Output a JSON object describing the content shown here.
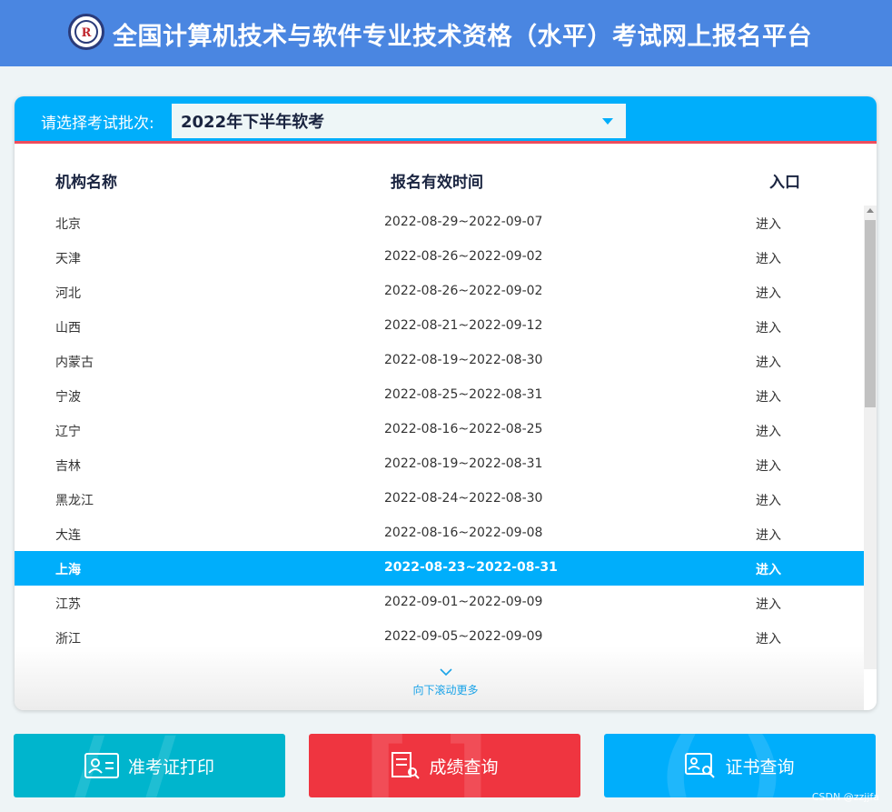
{
  "header": {
    "title": "全国计算机技术与软件专业技术资格（水平）考试网上报名平台"
  },
  "batch": {
    "label": "请选择考试批次:",
    "selected": "2022年下半年软考"
  },
  "table": {
    "headers": [
      "机构名称",
      "报名有效时间",
      "入口"
    ],
    "rows": [
      {
        "name": "北京",
        "period": "2022-08-29~2022-09-07",
        "entry": "进入"
      },
      {
        "name": "天津",
        "period": "2022-08-26~2022-09-02",
        "entry": "进入"
      },
      {
        "name": "河北",
        "period": "2022-08-26~2022-09-02",
        "entry": "进入"
      },
      {
        "name": "山西",
        "period": "2022-08-21~2022-09-12",
        "entry": "进入"
      },
      {
        "name": "内蒙古",
        "period": "2022-08-19~2022-08-30",
        "entry": "进入"
      },
      {
        "name": "宁波",
        "period": "2022-08-25~2022-08-31",
        "entry": "进入"
      },
      {
        "name": "辽宁",
        "period": "2022-08-16~2022-08-25",
        "entry": "进入"
      },
      {
        "name": "吉林",
        "period": "2022-08-19~2022-08-31",
        "entry": "进入"
      },
      {
        "name": "黑龙江",
        "period": "2022-08-24~2022-08-30",
        "entry": "进入"
      },
      {
        "name": "大连",
        "period": "2022-08-16~2022-09-08",
        "entry": "进入"
      },
      {
        "name": "上海",
        "period": "2022-08-23~2022-08-31",
        "entry": "进入",
        "highlighted": true
      },
      {
        "name": "江苏",
        "period": "2022-09-01~2022-09-09",
        "entry": "进入"
      },
      {
        "name": "浙江",
        "period": "2022-09-05~2022-09-09",
        "entry": "进入"
      }
    ]
  },
  "scroll_more": "向下滚动更多",
  "buttons": {
    "ticket": "准考证打印",
    "score": "成绩查询",
    "cert": "证书查询"
  },
  "watermark": "CSDN @zzjjfa",
  "colors": {
    "header": "#4a86e1",
    "accent": "#00aefb",
    "ticket": "#00b5cd",
    "score": "#ef3540",
    "cert": "#00aefb"
  }
}
